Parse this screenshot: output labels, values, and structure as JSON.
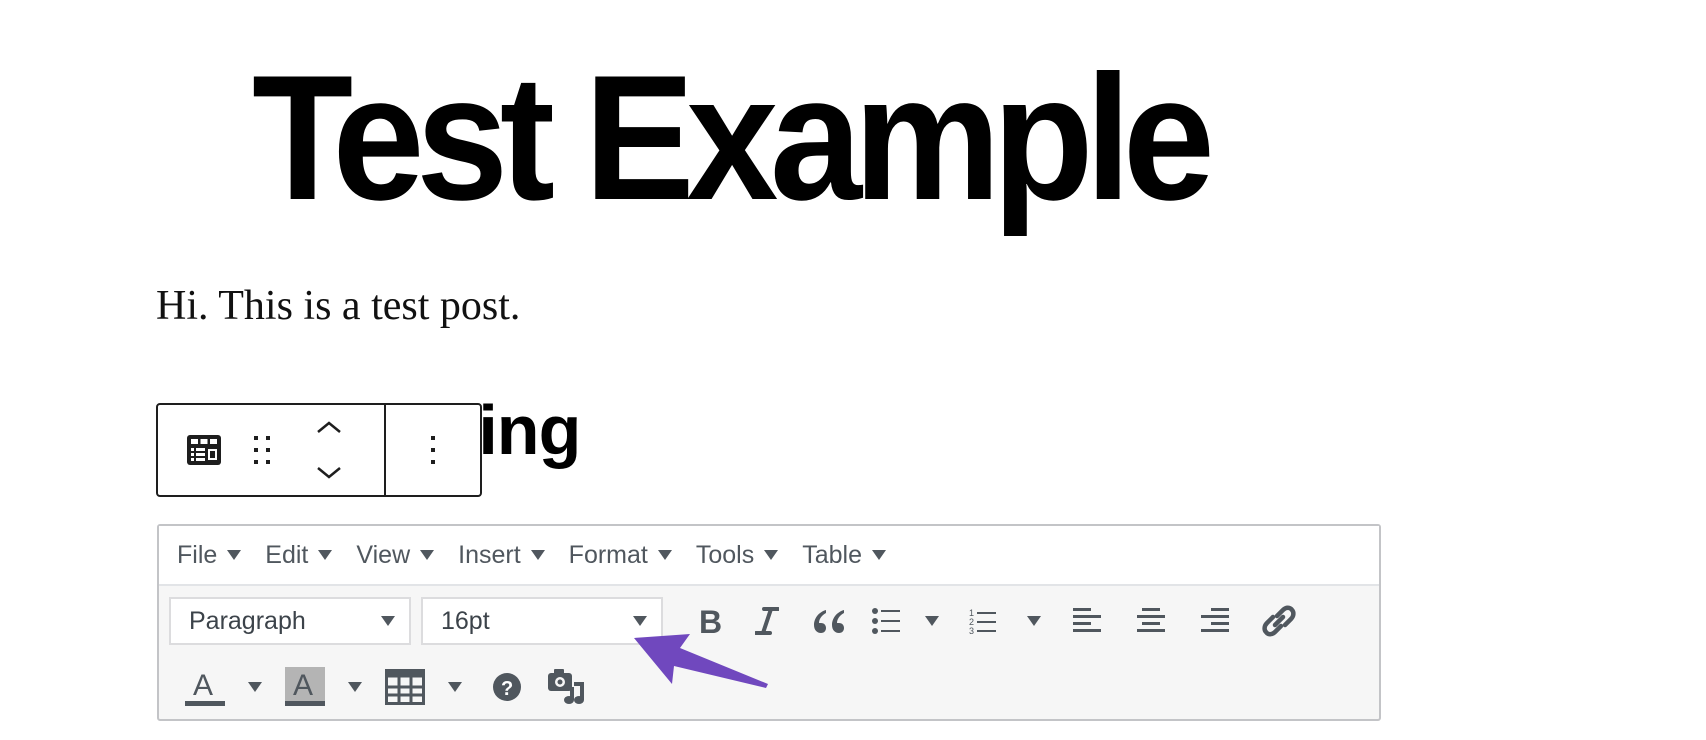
{
  "post": {
    "title": "Test Example",
    "paragraph": "Hi. This is a test post.",
    "heading": "Test Heading"
  },
  "block_toolbar": {
    "block_type_icon": "classic-block-icon",
    "drag_icon": "drag-handle-icon",
    "move_up_icon": "chevron-up-icon",
    "move_down_icon": "chevron-down-icon",
    "more_icon": "more-vertical-icon"
  },
  "editor": {
    "menubar": [
      {
        "label": "File"
      },
      {
        "label": "Edit"
      },
      {
        "label": "View"
      },
      {
        "label": "Insert"
      },
      {
        "label": "Format"
      },
      {
        "label": "Tools"
      },
      {
        "label": "Table"
      }
    ],
    "toolbar": {
      "block_format": "Paragraph",
      "font_size": "16pt",
      "buttons_row1": [
        "bold",
        "italic",
        "blockquote",
        "bullet-list",
        "numbered-list",
        "align-left",
        "align-center",
        "align-right",
        "link"
      ],
      "buttons_row2": [
        "text-color",
        "background-color",
        "table",
        "help",
        "insert-media"
      ]
    }
  },
  "colors": {
    "icon": "#50575e",
    "annotation_arrow": "#7048be",
    "editor_border": "#c3c4c7",
    "highlight_swatch": "#b4b4b4"
  }
}
